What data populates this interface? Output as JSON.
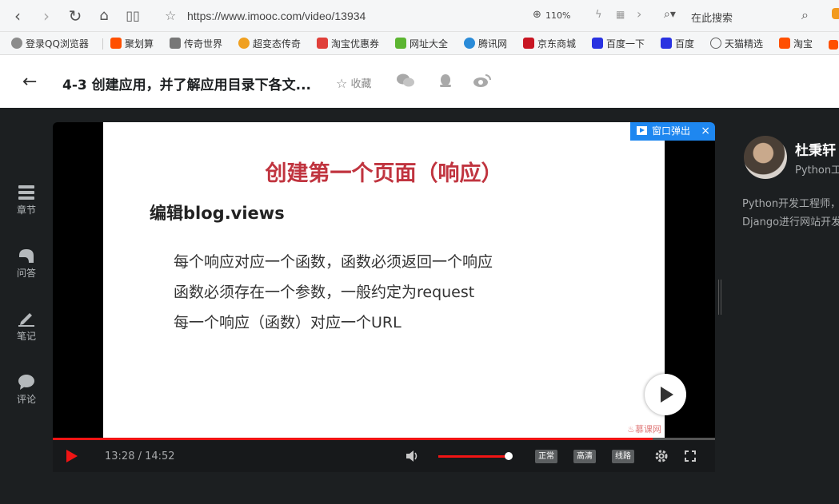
{
  "browser": {
    "url": "https://www.imooc.com/video/13934",
    "zoom": "110%",
    "search_placeholder": "在此搜索"
  },
  "bookmarks": [
    {
      "label": "登录QQ浏览器",
      "icon": "user-icon",
      "color": "#888888"
    },
    {
      "label": "聚划算",
      "icon": "juhuasuan-icon",
      "color": "#ff5000"
    },
    {
      "label": "传奇世界",
      "icon": "game-icon",
      "color": "#666666"
    },
    {
      "label": "超变态传奇",
      "icon": "smile-icon",
      "color": "#f0a020"
    },
    {
      "label": "淘宝优惠券",
      "icon": "coupon-icon",
      "color": "#e0403a"
    },
    {
      "label": "网址大全",
      "icon": "hao-icon",
      "color": "#5cb531"
    },
    {
      "label": "腾讯网",
      "icon": "tencent-icon",
      "color": "#2a8bd8"
    },
    {
      "label": "京东商城",
      "icon": "jd-icon",
      "color": "#c81623"
    },
    {
      "label": "百度一下",
      "icon": "baidu-icon",
      "color": "#2932e1"
    },
    {
      "label": "百度",
      "icon": "baidu-icon",
      "color": "#2932e1"
    },
    {
      "label": "天猫精选",
      "icon": "globe-icon",
      "color": "#666666"
    },
    {
      "label": "淘宝",
      "icon": "taobao-icon",
      "color": "#ff5000"
    }
  ],
  "header": {
    "title": "4-3 创建应用，并了解应用目录下各文...",
    "favorite_label": "收藏"
  },
  "side_nav": [
    {
      "label": "章节",
      "icon": "chapters-icon"
    },
    {
      "label": "问答",
      "icon": "qa-icon"
    },
    {
      "label": "笔记",
      "icon": "note-icon"
    },
    {
      "label": "评论",
      "icon": "comment-icon"
    }
  ],
  "slide": {
    "title": "创建第一个页面（响应）",
    "subtitle": "编辑blog.views",
    "lines": [
      "每个响应对应一个函数，函数必须返回一个响应",
      "函数必须存在一个参数，一般约定为request",
      "每一个响应（函数）对应一个URL"
    ],
    "logo": "慕课网"
  },
  "player": {
    "popout_label": "窗口弹出",
    "time": "13:28 / 14:52",
    "progress": 0.906,
    "volume": 0.95,
    "speed_label": "正常",
    "quality_label": "高清",
    "route_label": "线路"
  },
  "teacher": {
    "name": "杜秉轩",
    "title": "Python工",
    "desc_line1": "Python开发工程师，",
    "desc_line2": "Django进行网站开发"
  },
  "colors": {
    "accent_red": "#f01414",
    "popout_blue": "#1e87f0",
    "slide_title": "#c0343f"
  }
}
